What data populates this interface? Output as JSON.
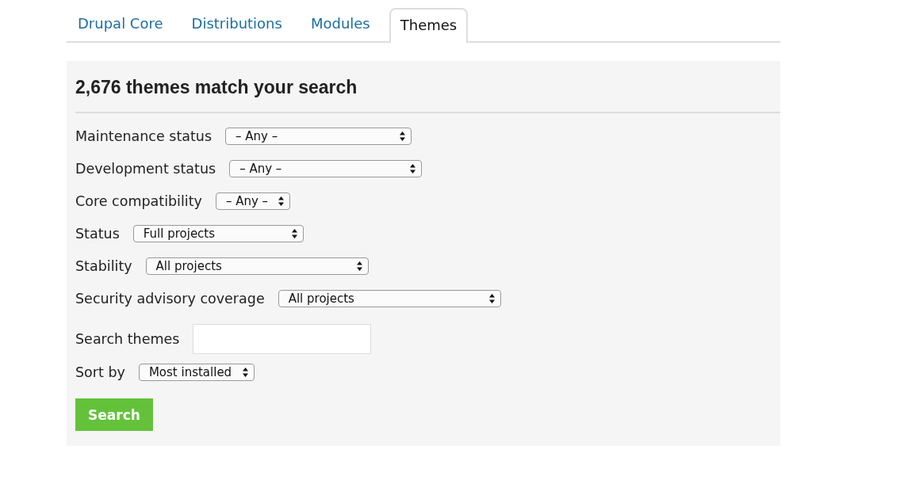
{
  "tabs": [
    {
      "label": "Drupal Core",
      "selected": false
    },
    {
      "label": "Distributions",
      "selected": false
    },
    {
      "label": "Modules",
      "selected": false
    },
    {
      "label": "Themes",
      "selected": true
    }
  ],
  "results_heading": "2,676 themes match your search",
  "filters": [
    {
      "kind": "select",
      "label": "Maintenance status",
      "value": "– Any –"
    },
    {
      "kind": "select",
      "label": "Development status",
      "value": "– Any –"
    },
    {
      "kind": "select",
      "label": "Core compatibility",
      "value": "– Any –"
    },
    {
      "kind": "select",
      "label": "Status",
      "value": "Full projects"
    },
    {
      "kind": "select",
      "label": "Stability",
      "value": "All projects"
    },
    {
      "kind": "select",
      "label": "Security advisory coverage",
      "value": "All projects"
    },
    {
      "kind": "text",
      "label": "Search themes"
    },
    {
      "kind": "select",
      "label": "Sort by",
      "value": "Most installed"
    }
  ],
  "submit_button": "Search"
}
